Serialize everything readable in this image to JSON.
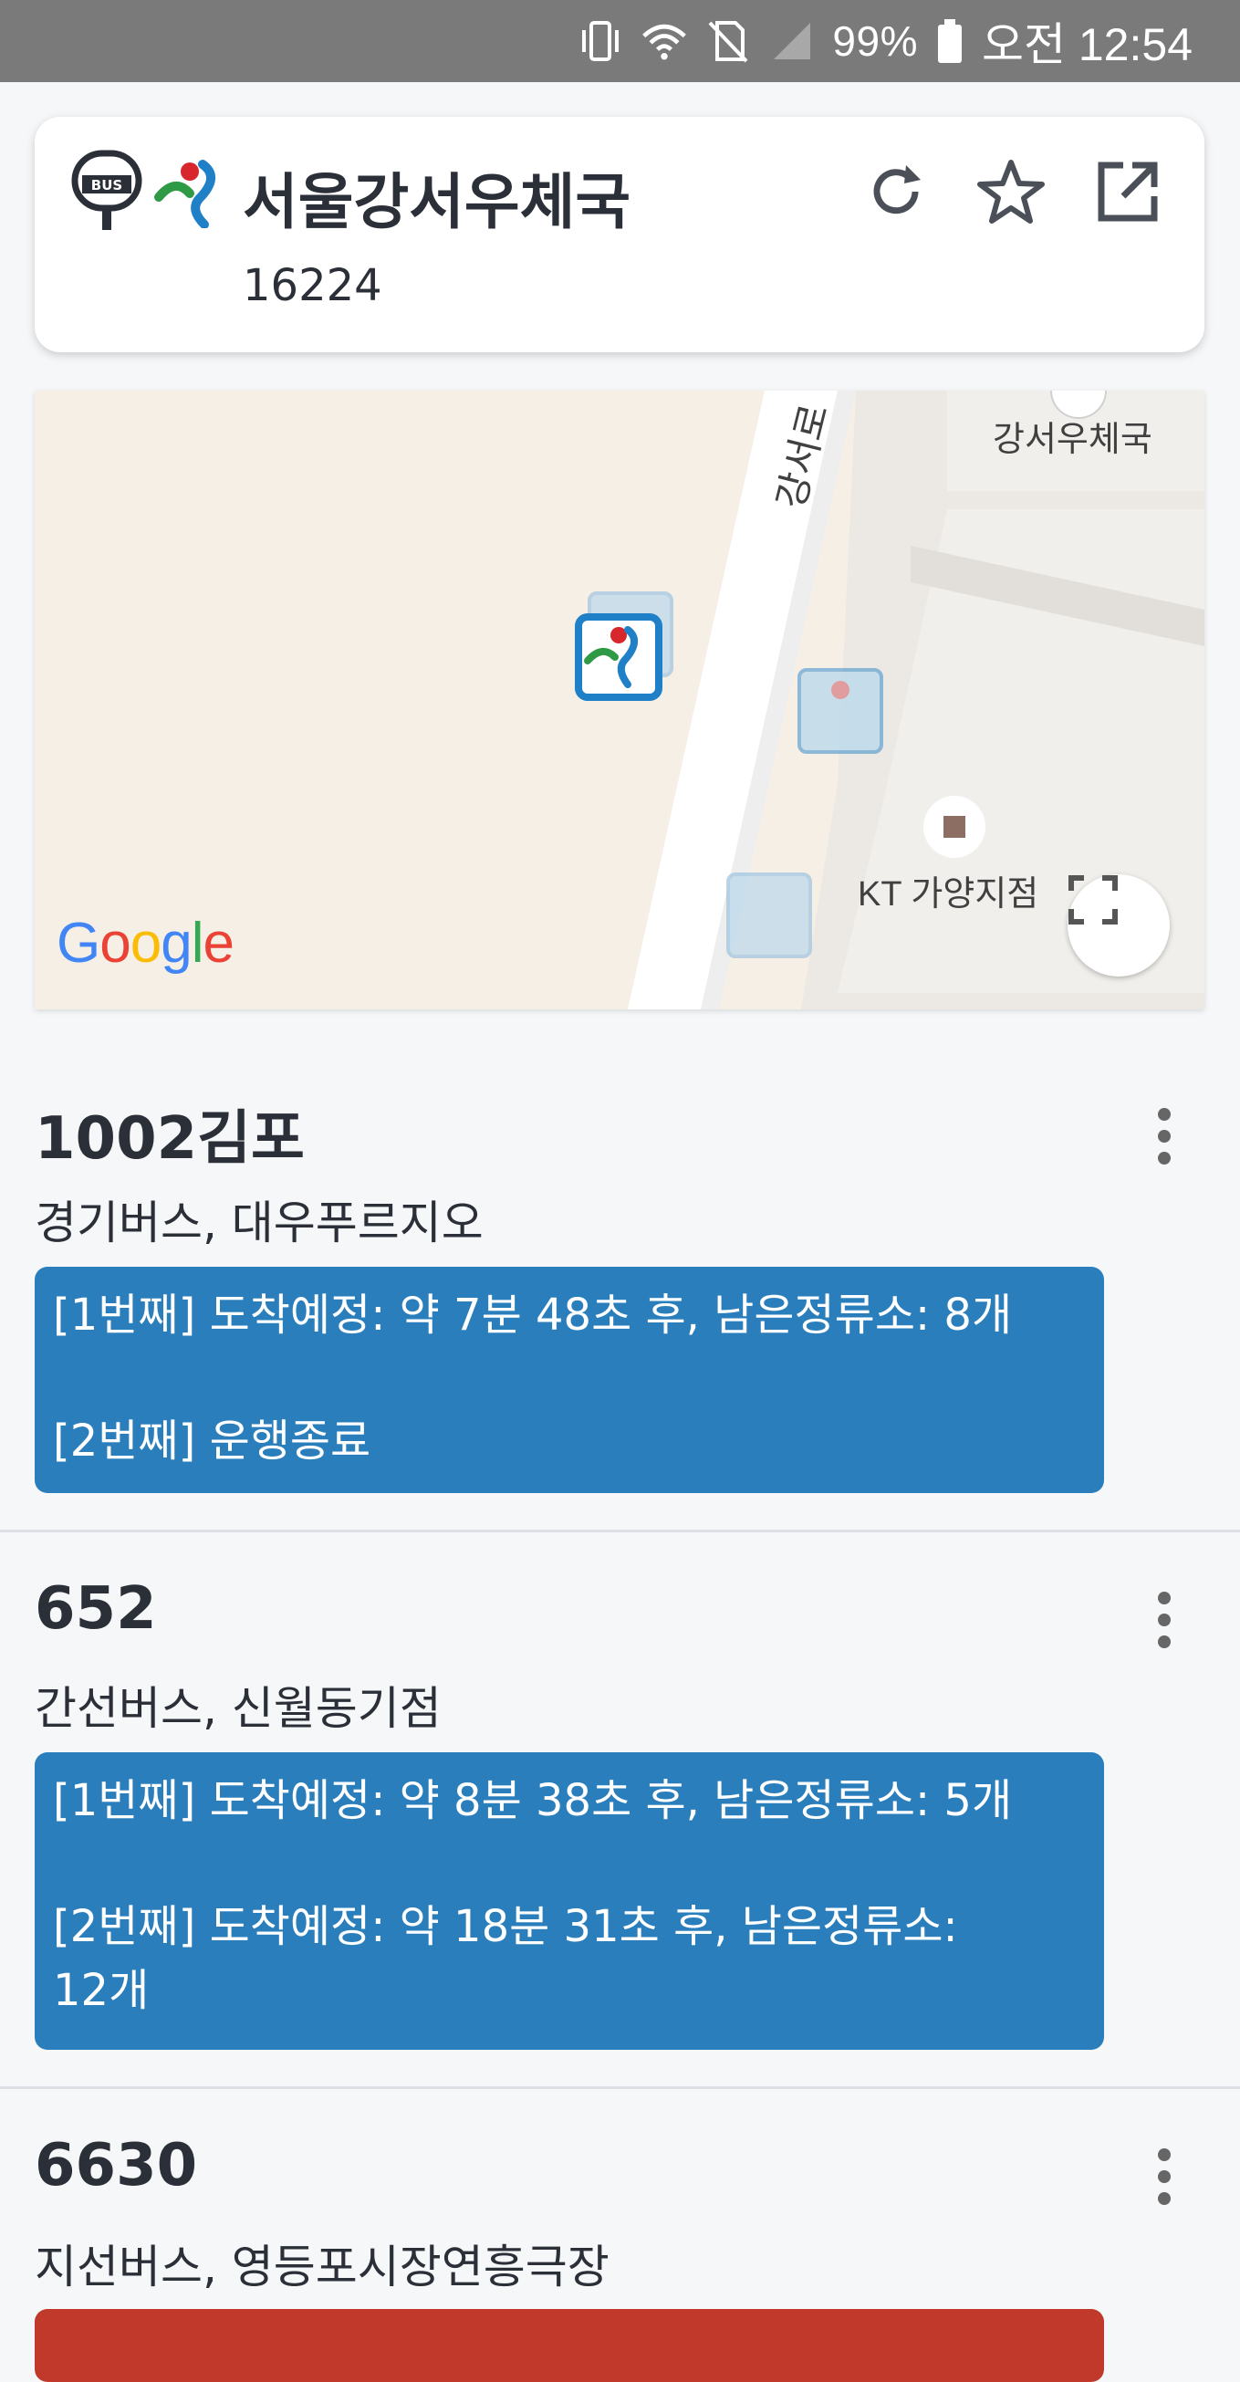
{
  "status_bar": {
    "battery": "99%",
    "time": "오전 12:54",
    "icons": [
      "vibrate-icon",
      "wifi-icon",
      "no-sim-icon",
      "signal-icon",
      "battery-icon"
    ]
  },
  "header": {
    "title": "서울강서우체국",
    "stop_number": "16224",
    "icons": [
      "bus-stop-icon",
      "seoul-logo-icon",
      "refresh-icon",
      "star-icon",
      "open-external-icon"
    ]
  },
  "map": {
    "labels": {
      "road": "강서로",
      "post_office": "강서우체국",
      "kt": "KT 가양지점"
    },
    "attribution": "Google"
  },
  "routes": [
    {
      "name": "1002김포",
      "sub": "경기버스, 대우푸르지오",
      "box_color": "#2a7ebb",
      "arrivals": [
        "[1번째] 도착예정: 약 7분 48초 후, 남은정류소: 8개",
        "[2번째] 운행종료"
      ]
    },
    {
      "name": "652",
      "sub": "간선버스, 신월동기점",
      "box_color": "#2a7ebb",
      "arrivals": [
        "[1번째] 도착예정: 약 8분 38초 후, 남은정류소: 5개",
        "[2번째] 도착예정: 약 18분 31초 후, 남은정류소:",
        "12개"
      ]
    },
    {
      "name": "6630",
      "sub": "지선버스, 영등포시장연흥극장",
      "box_color": "#c0392b",
      "arrivals": []
    }
  ]
}
